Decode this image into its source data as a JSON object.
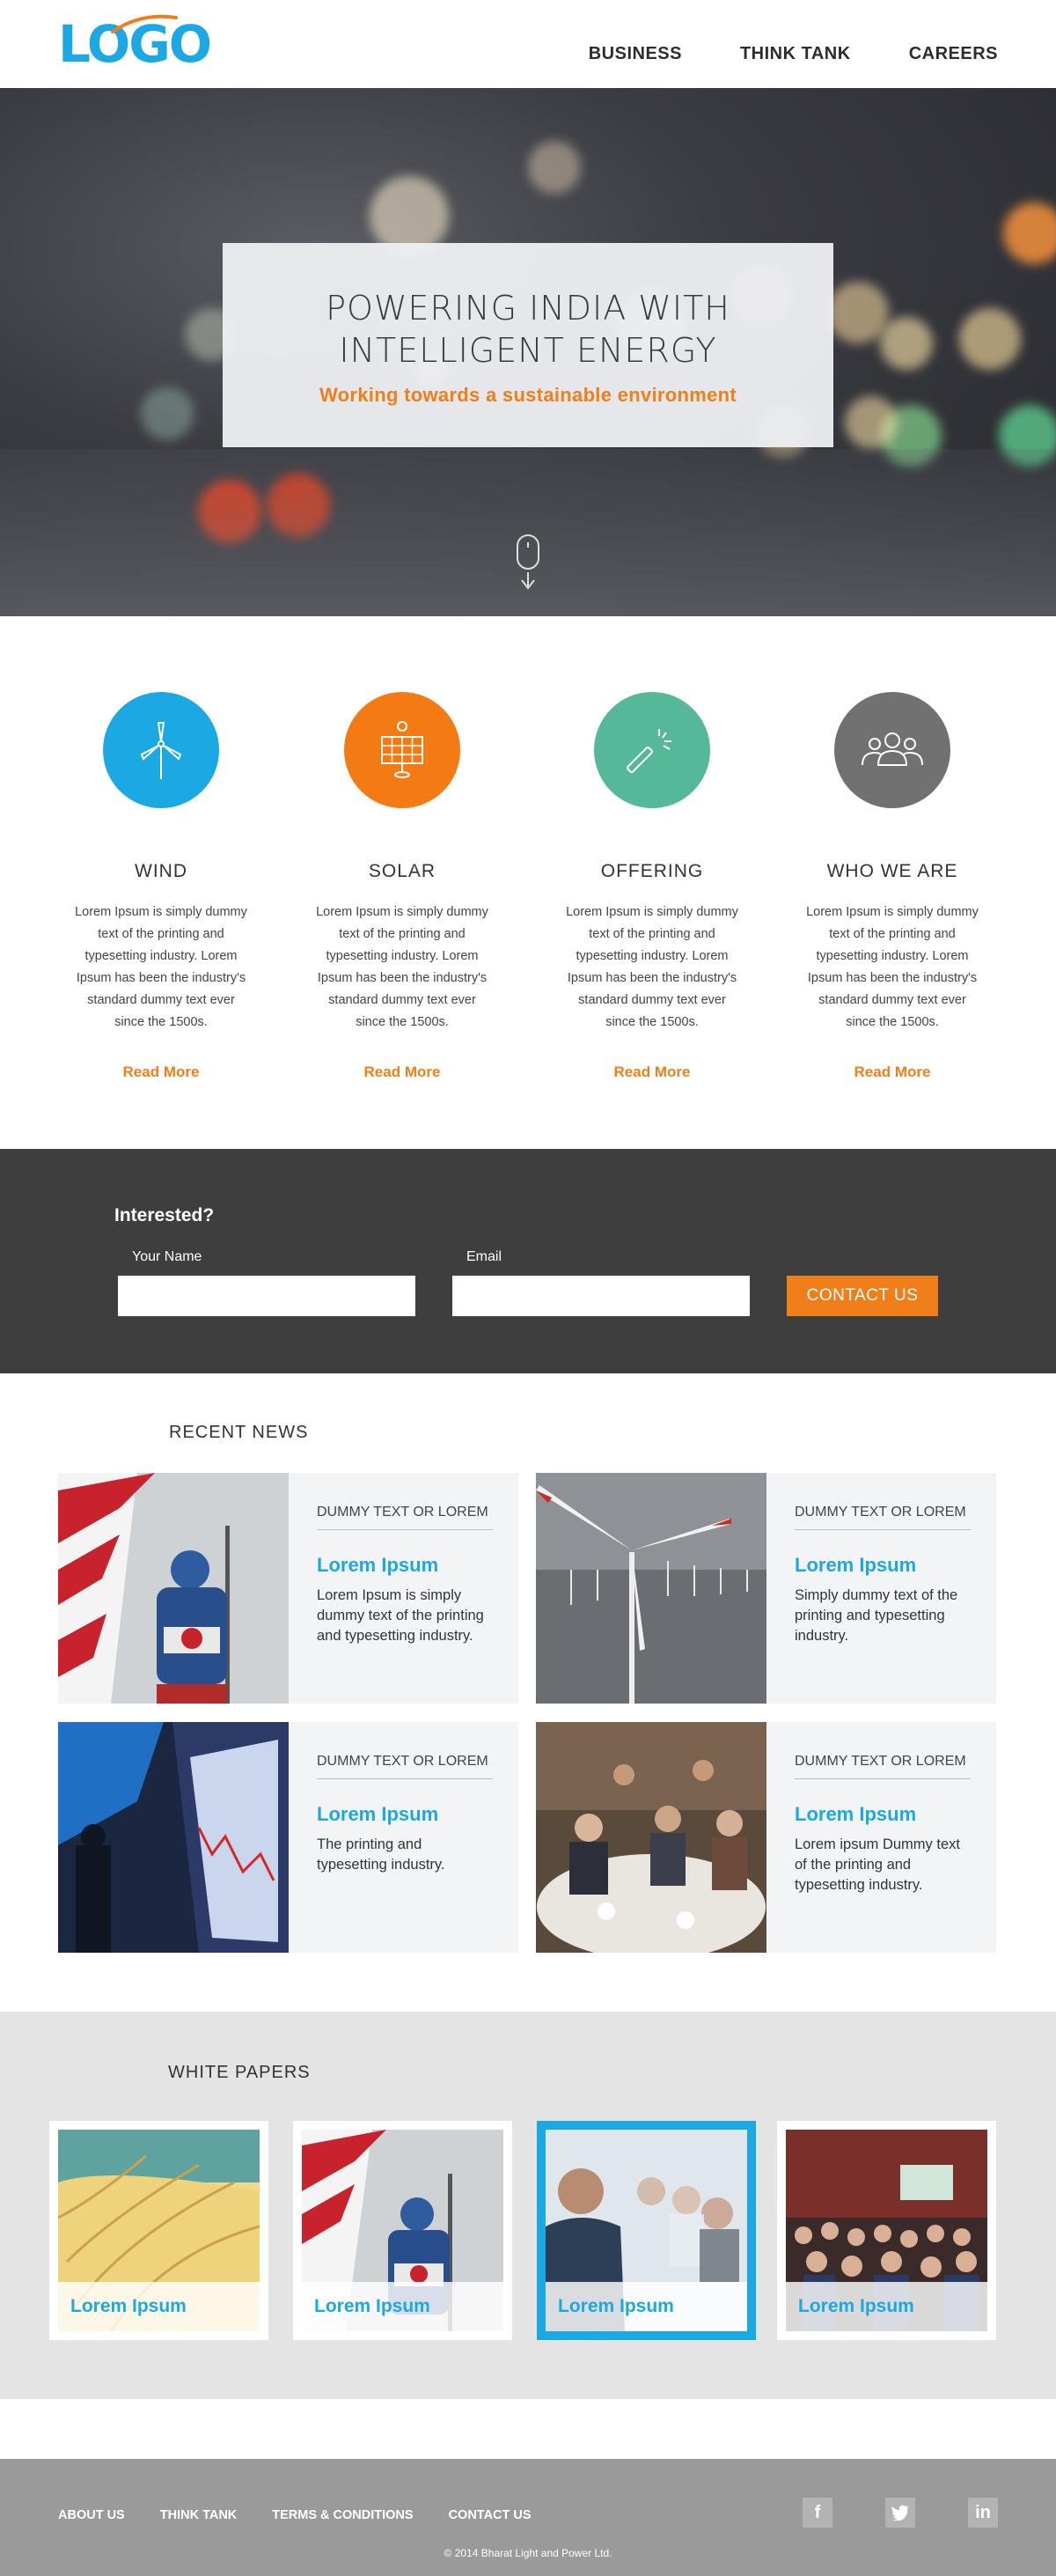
{
  "header": {
    "logo": "LOGO",
    "nav": [
      "BUSINESS",
      "THINK TANK",
      "CAREERS"
    ]
  },
  "hero": {
    "title_line1": "POWERING INDIA WITH",
    "title_line2": "INTELLIGENT ENERGY",
    "subtitle": "Working towards a sustainable environment",
    "scroll_icon": "mouse-scroll-icon"
  },
  "features": [
    {
      "title": "WIND",
      "icon": "wind-turbine-icon",
      "color": "#1ba8e3",
      "text": "Lorem Ipsum is simply dummy text of the printing and typesetting industry. Lorem Ipsum has been the industry's standard dummy text ever since the 1500s.",
      "more": "Read More"
    },
    {
      "title": "SOLAR",
      "icon": "solar-panel-icon",
      "color": "#f47a14",
      "text": "Lorem Ipsum is simply dummy text of the printing and typesetting industry. Lorem Ipsum has been the industry's standard dummy text ever since the 1500s.",
      "more": "Read More"
    },
    {
      "title": "OFFERING",
      "icon": "magic-wand-icon",
      "color": "#55b899",
      "text": "Lorem Ipsum is simply dummy text of the printing and typesetting industry. Lorem Ipsum has been the industry's standard dummy text ever since the 1500s.",
      "more": "Read More"
    },
    {
      "title": "WHO WE ARE",
      "icon": "people-group-icon",
      "color": "#717171",
      "text": "Lorem Ipsum is simply dummy text of the printing and typesetting industry. Lorem Ipsum has been the industry's standard dummy text ever since the 1500s.",
      "more": "Read More"
    }
  ],
  "interested": {
    "title": "Interested?",
    "name_label": "Your Name",
    "name_value": "",
    "email_label": "Email",
    "email_value": "",
    "button": "CONTACT US"
  },
  "news": {
    "title": "RECENT NEWS",
    "items": [
      {
        "category": "DUMMY TEXT OR LOREM",
        "headline": "Lorem Ipsum",
        "text": "Lorem Ipsum is simply dummy text of the printing and typesetting industry."
      },
      {
        "category": "DUMMY TEXT OR LOREM",
        "headline": "Lorem Ipsum",
        "text": "Simply dummy text of the printing and typesetting industry."
      },
      {
        "category": "DUMMY TEXT OR LOREM",
        "headline": "Lorem Ipsum",
        "text": "The printing and typesetting industry."
      },
      {
        "category": "DUMMY TEXT OR LOREM",
        "headline": "Lorem Ipsum",
        "text": "Lorem ipsum Dummy text of the printing and typesetting industry."
      }
    ]
  },
  "papers": {
    "title": "WHITE PAPERS",
    "items": [
      {
        "caption": "Lorem Ipsum",
        "selected": false
      },
      {
        "caption": "Lorem Ipsum",
        "selected": false
      },
      {
        "caption": "Lorem Ipsum",
        "selected": true
      },
      {
        "caption": "Lorem Ipsum",
        "selected": false
      }
    ]
  },
  "footer": {
    "links": [
      "ABOUT US",
      "THINK TANK",
      "TERMS & CONDITIONS",
      "CONTACT US"
    ],
    "socials": [
      {
        "icon": "facebook-icon",
        "glyph": "f"
      },
      {
        "icon": "twitter-icon",
        "glyph": "t"
      },
      {
        "icon": "linkedin-icon",
        "glyph": "in"
      }
    ],
    "copyright": "© 2014 Bharat Light and Power Ltd."
  },
  "colors": {
    "accent_blue": "#1ba8e3",
    "accent_orange": "#f07f1a",
    "dark_band": "#3e3e3e",
    "footer": "#9a9a9a"
  }
}
